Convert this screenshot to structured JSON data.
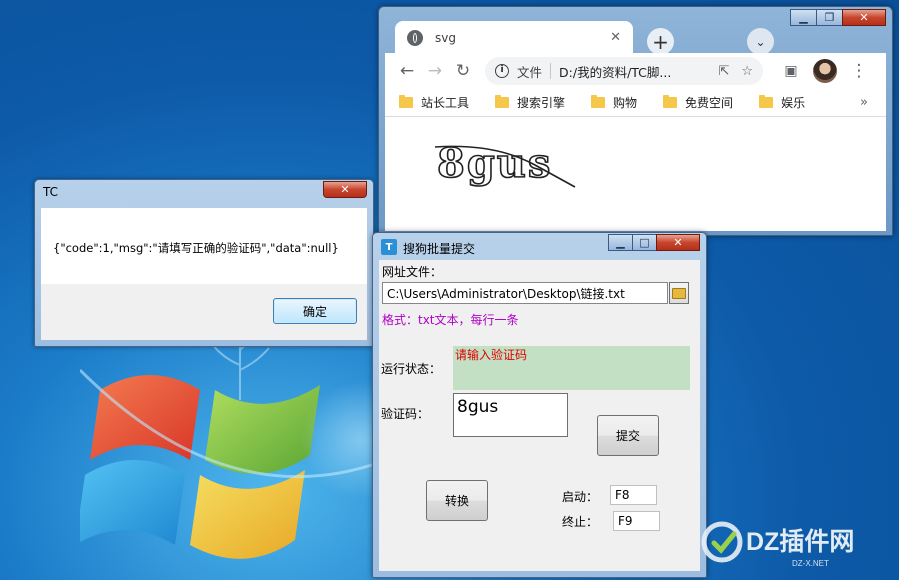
{
  "desktop": {
    "watermark": {
      "brand": "DZ插件网",
      "sub": "DZ-X.NET"
    }
  },
  "browser": {
    "tab_title": "svg",
    "tab_close": "✕",
    "omnibox": {
      "security_label": "文件",
      "url": "D:/我的资料/TC脚..."
    },
    "bookmarks": [
      "站长工具",
      "搜索引擎",
      "购物",
      "免费空间",
      "娱乐"
    ],
    "captcha_text": "8gus"
  },
  "message_box": {
    "title": "TC",
    "message": "{\"code\":1,\"msg\":\"请填写正确的验证码\",\"data\":null}",
    "ok_label": "确定"
  },
  "app": {
    "title": "搜狗批量提交",
    "icon_text": "T",
    "url_file_label": "网址文件：",
    "url_file_value": "C:\\Users\\Administrator\\Desktop\\链接.txt",
    "format_hint": "格式：txt文本，每行一条",
    "status_label": "运行状态：",
    "status_value": "请输入验证码",
    "captcha_label": "验证码：",
    "captcha_value": "8gus",
    "submit_label": "提交",
    "convert_label": "转换",
    "start_label": "启动：",
    "start_key": "F8",
    "stop_label": "终止：",
    "stop_key": "F9"
  },
  "colors": {
    "status_bg": "#c3dfc4",
    "status_text": "#e00000",
    "hint_text": "#b000c8",
    "desktop_blue": "#0d5aa8"
  }
}
